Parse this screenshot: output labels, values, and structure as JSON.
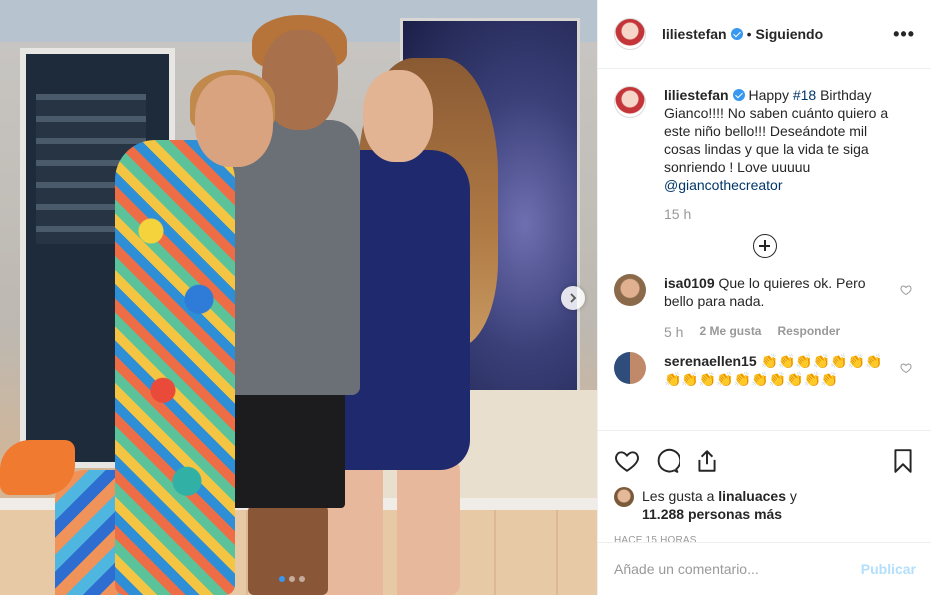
{
  "post": {
    "username": "liliestefan",
    "verified": true,
    "separator": "•",
    "follow_status": "Siguiendo",
    "more_icon": "more-horizontal-icon",
    "more_label": "•••"
  },
  "caption": {
    "username": "liliestefan",
    "text_before_tag": "Happy ",
    "hashtag": "#18",
    "text_after_tag": " Birthday Gianco!!!! No saben cuánto quiero a este niño bello!!! Deseándote mil cosas lindas y que la vida te siga sonriendo ! Love uuuuu",
    "mention": "@giancothecreator",
    "time": "15 h"
  },
  "comments": [
    {
      "username": "isa0109",
      "text": "Que lo quieres ok. Pero bello para nada.",
      "time": "5 h",
      "likes": "2 Me gusta",
      "reply": "Responder"
    },
    {
      "username": "serenaellen15",
      "text": "👏👏👏👏👏👏👏👏👏👏👏👏👏👏👏👏👏"
    }
  ],
  "likes": {
    "prefix": "Les gusta a ",
    "user": "linaluaces",
    "connector": " y",
    "others": "11.288 personas más"
  },
  "timestamp": "HACE 15 HORAS",
  "comment_input": {
    "placeholder": "Añade un comentario...",
    "post_label": "Publicar"
  },
  "carousel": {
    "current": 1,
    "total": 3
  },
  "icons": {
    "like": "heart-icon",
    "comment": "comment-icon",
    "share": "share-icon",
    "save": "bookmark-icon",
    "next": "chevron-right-icon",
    "add_comments": "plus-circle-icon"
  },
  "colors": {
    "verified": "#3897f0",
    "link": "#003569",
    "muted": "#999999",
    "post_disabled": "#b2dffc"
  }
}
